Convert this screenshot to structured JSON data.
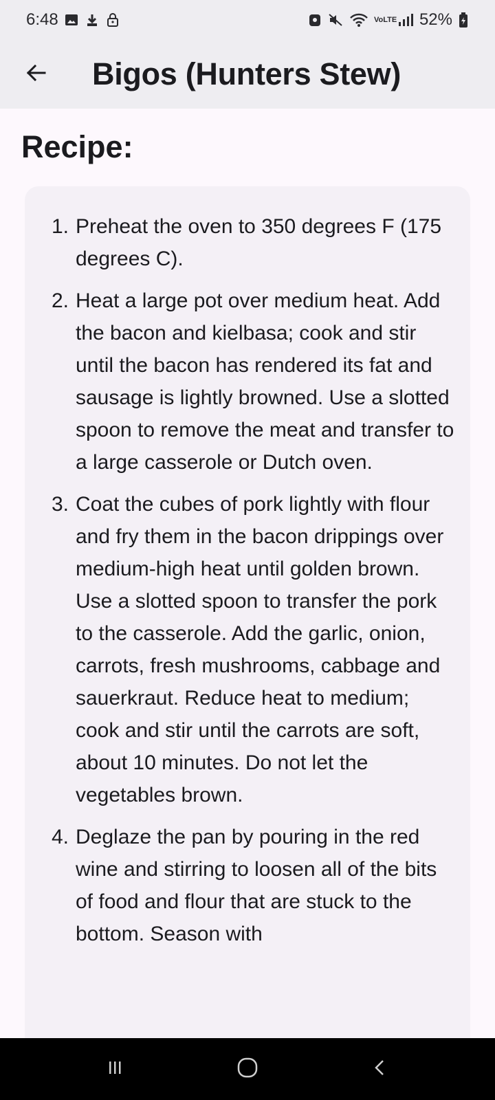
{
  "status_bar": {
    "time": "6:48",
    "battery": "52%",
    "network_label": "VoLTE",
    "icons_left": [
      "image-icon",
      "download-icon",
      "lock-icon"
    ],
    "icons_right": [
      "vpn-icon",
      "mute-icon",
      "wifi-icon",
      "signal-icon",
      "battery-icon"
    ]
  },
  "app_bar": {
    "title": "Bigos (Hunters Stew)",
    "back_icon": "arrow-left-icon"
  },
  "section": {
    "title": "Recipe:"
  },
  "steps": [
    {
      "number": "1.",
      "text": "Preheat the oven to 350 degrees F (175 degrees C)."
    },
    {
      "number": "2.",
      "text": "Heat a large pot over medium heat. Add the bacon and kielbasa; cook and stir until the bacon has rendered its fat and sausage is lightly browned. Use a slotted spoon to remove the meat and transfer to a large casserole or Dutch oven."
    },
    {
      "number": "3.",
      "text": "Coat the cubes of pork lightly with flour and fry them in the bacon drippings over medium-high heat until golden brown. Use a slotted spoon to transfer the pork to the casserole. Add the garlic, onion, carrots, fresh mushrooms, cabbage and sauerkraut. Reduce heat to medium; cook and stir until the carrots are soft, about 10 minutes. Do not let the vegetables brown."
    },
    {
      "number": "4.",
      "text": "Deglaze the pan by pouring in the red wine and stirring to loosen all of the bits of food and flour that are stuck to the bottom. Season with"
    }
  ],
  "nav_bar": {
    "buttons": [
      "recents-icon",
      "home-icon",
      "back-icon"
    ]
  },
  "colors": {
    "background": "#fdf8fd",
    "app_bar": "#eeedf1",
    "card": "#f4f0f6",
    "text": "#1b1b1f",
    "nav_bar": "#000000"
  }
}
